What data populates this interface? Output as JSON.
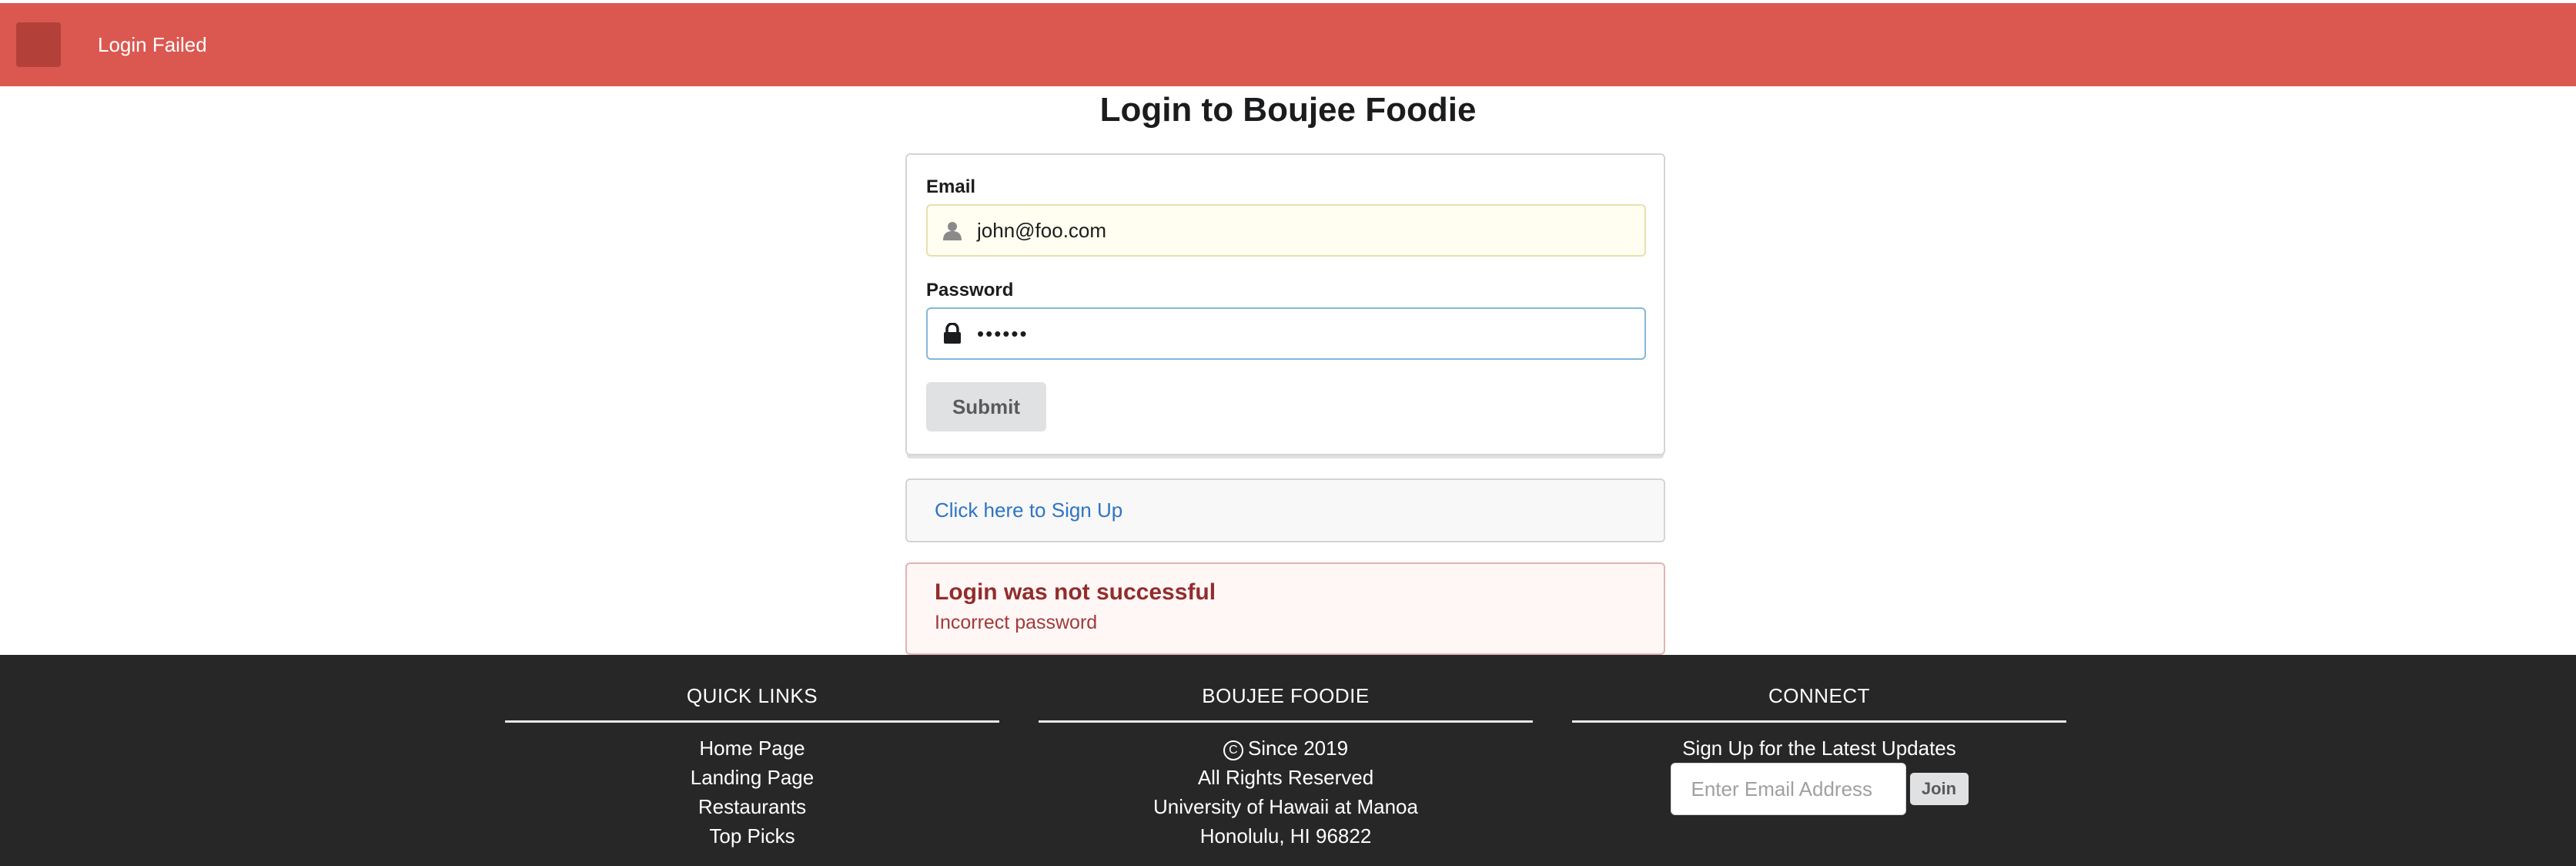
{
  "toast": {
    "title": "Login Failed"
  },
  "page": {
    "title": "Login to Boujee Foodie"
  },
  "form": {
    "email_label": "Email",
    "email_value": "john@foo.com",
    "email_icon": "user-icon",
    "password_label": "Password",
    "password_value": "••••••",
    "password_icon": "lock-icon",
    "submit_label": "Submit"
  },
  "signup": {
    "link_text": "Click here to Sign Up"
  },
  "error": {
    "title": "Login was not successful",
    "message": "Incorrect password"
  },
  "footer": {
    "quick_links": {
      "heading": "QUICK LINKS",
      "items": [
        "Home Page",
        "Landing Page",
        "Restaurants",
        "Top Picks"
      ]
    },
    "brand": {
      "heading": "BOUJEE FOODIE",
      "since": "Since 2019",
      "rights": "All Rights Reserved",
      "school": "University of Hawaii at Manoa",
      "address": "Honolulu, HI 96822"
    },
    "connect": {
      "heading": "CONNECT",
      "tagline": "Sign Up for the Latest Updates",
      "email_placeholder": "Enter Email Address",
      "join_label": "Join"
    }
  },
  "colors": {
    "toast_bg": "#db5850",
    "footer_bg": "#272727",
    "link": "#2e74c4",
    "error_text": "#912d2b"
  }
}
